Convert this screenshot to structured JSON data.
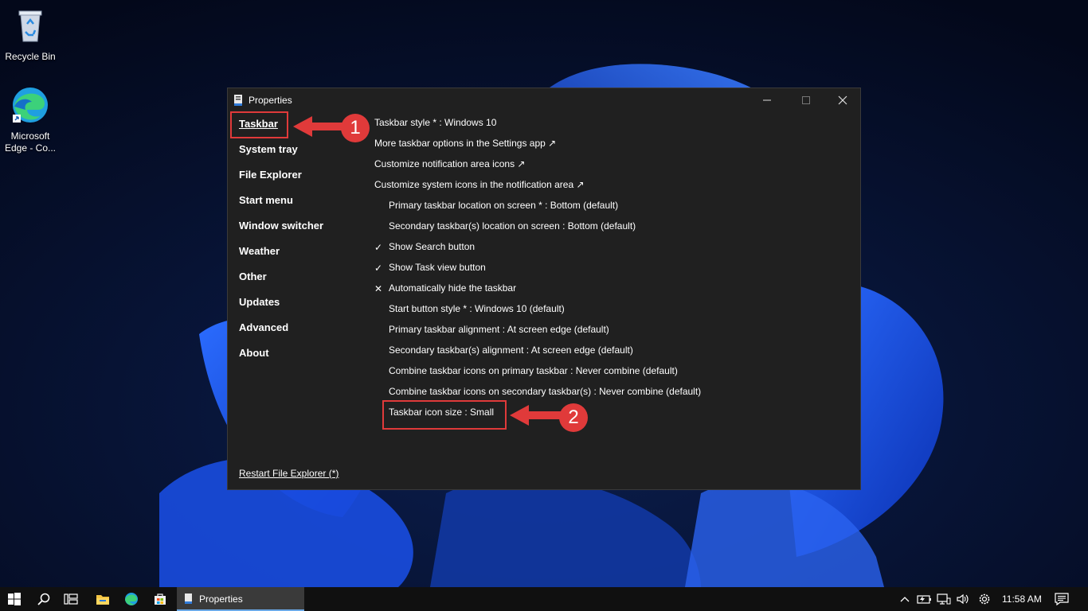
{
  "desktop": {
    "icons": [
      {
        "label": "Recycle Bin"
      },
      {
        "label": "Microsoft Edge - Co..."
      }
    ]
  },
  "window": {
    "title": "Properties",
    "nav": [
      {
        "label": "Taskbar",
        "active": true
      },
      {
        "label": "System tray"
      },
      {
        "label": "File Explorer"
      },
      {
        "label": "Start menu"
      },
      {
        "label": "Window switcher"
      },
      {
        "label": "Weather"
      },
      {
        "label": "Other"
      },
      {
        "label": "Updates"
      },
      {
        "label": "Advanced"
      },
      {
        "label": "About"
      }
    ],
    "settings": [
      {
        "label": "Taskbar style * : Windows 10",
        "mark": ""
      },
      {
        "label": "More taskbar options in the Settings app ↗",
        "mark": ""
      },
      {
        "label": "Customize notification area icons ↗",
        "mark": ""
      },
      {
        "label": "Customize system icons in the notification area ↗",
        "mark": ""
      },
      {
        "label": "Primary taskbar location on screen * : Bottom (default)",
        "mark": ""
      },
      {
        "label": "Secondary taskbar(s) location on screen : Bottom (default)",
        "mark": ""
      },
      {
        "label": "Show Search button",
        "mark": "✓"
      },
      {
        "label": "Show Task view button",
        "mark": "✓"
      },
      {
        "label": "Automatically hide the taskbar",
        "mark": "✕"
      },
      {
        "label": "Start button style * : Windows 10 (default)",
        "mark": ""
      },
      {
        "label": "Primary taskbar alignment : At screen edge (default)",
        "mark": ""
      },
      {
        "label": "Secondary taskbar(s) alignment : At screen edge (default)",
        "mark": ""
      },
      {
        "label": "Combine taskbar icons on primary taskbar : Never combine (default)",
        "mark": ""
      },
      {
        "label": "Combine taskbar icons on secondary taskbar(s) : Never combine (default)",
        "mark": ""
      },
      {
        "label": "Taskbar icon size : Small",
        "mark": ""
      }
    ],
    "restart_link": "Restart File Explorer (*)"
  },
  "annotations": {
    "callout_1": "1",
    "callout_2": "2",
    "color": "#e03a3a"
  },
  "taskbar": {
    "task_label": "Properties",
    "clock": "11:58 AM",
    "icons": [
      "start-icon",
      "search-icon",
      "task-view-icon",
      "file-explorer-icon",
      "edge-icon",
      "store-icon"
    ],
    "tray_icons": [
      "chevron-up-icon",
      "battery-icon",
      "network-icon",
      "volume-icon",
      "settings-icon",
      "notification-icon"
    ]
  }
}
